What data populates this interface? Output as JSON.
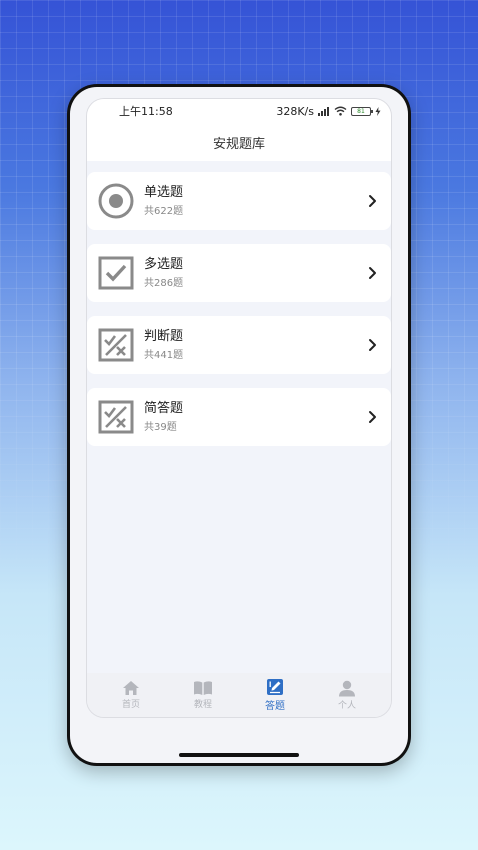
{
  "status": {
    "time": "上午11:58",
    "speed": "328K/s",
    "battery": "81"
  },
  "header": {
    "title": "安规题库"
  },
  "categories": [
    {
      "title": "单选题",
      "count": "共622题",
      "icon": "radio-icon"
    },
    {
      "title": "多选题",
      "count": "共286题",
      "icon": "checkbox-icon"
    },
    {
      "title": "判断题",
      "count": "共441题",
      "icon": "true-false-icon"
    },
    {
      "title": "简答题",
      "count": "共39题",
      "icon": "short-answer-icon"
    }
  ],
  "tabbar": {
    "items": [
      {
        "label": "首页",
        "icon": "home-icon"
      },
      {
        "label": "教程",
        "icon": "book-icon"
      },
      {
        "label": "答题",
        "icon": "pen-icon",
        "active": true
      },
      {
        "label": "个人",
        "icon": "user-icon"
      }
    ]
  },
  "colors": {
    "accent": "#2f6fc5",
    "icon_gray": "#8a8a8a"
  }
}
